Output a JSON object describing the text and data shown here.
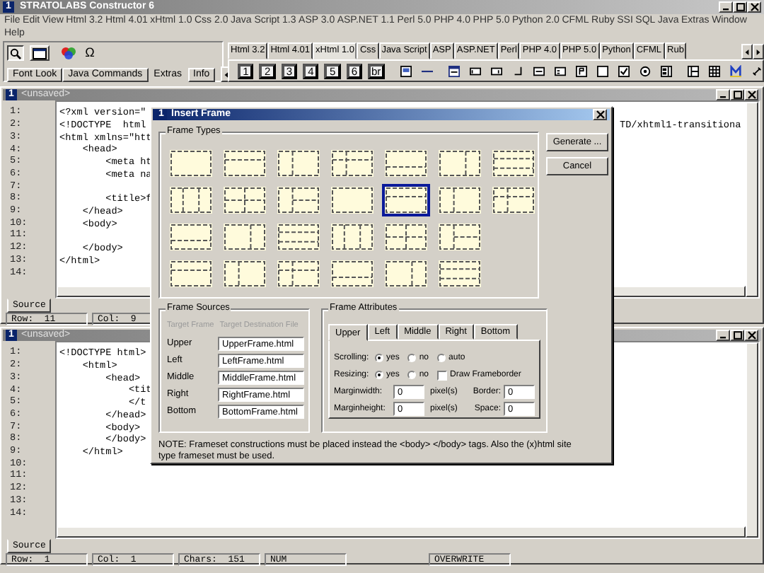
{
  "app": {
    "number": "1",
    "title": "STRATOLABS Constructor 6"
  },
  "menu": {
    "rows": [
      [
        "File",
        "Edit",
        "View",
        "Html 3.2",
        "Html 4.01",
        "xHtml 1.0",
        "Css 2.0",
        "Java Script 1.3",
        "ASP 3.0",
        "ASP.NET 1.1",
        "Perl 5.0",
        "PHP 4.0",
        "PHP 5.0",
        "Python 2.0",
        "CFML",
        "Ruby",
        "SSI",
        "SQL",
        "Java",
        "Extras",
        "Window"
      ],
      [
        "Help"
      ]
    ]
  },
  "side_toolbar": {
    "symbol_button": "Ω",
    "tabs": [
      {
        "label": "Font Look",
        "selected": false
      },
      {
        "label": "Java Commands",
        "selected": false
      },
      {
        "label": "Extras",
        "selected": true
      },
      {
        "label": "Info",
        "selected": false
      }
    ]
  },
  "language_tabs": [
    {
      "label": "Html 3.2",
      "selected": false
    },
    {
      "label": "Html 4.01",
      "selected": false
    },
    {
      "label": "xHtml 1.0",
      "selected": true
    },
    {
      "label": "Css",
      "selected": false
    },
    {
      "label": "Java Script",
      "selected": false
    },
    {
      "label": "ASP",
      "selected": false
    },
    {
      "label": "ASP.NET",
      "selected": false
    },
    {
      "label": "Perl",
      "selected": false
    },
    {
      "label": "PHP 4.0",
      "selected": false
    },
    {
      "label": "PHP 5.0",
      "selected": false
    },
    {
      "label": "Python",
      "selected": false
    },
    {
      "label": "CFML",
      "selected": false
    },
    {
      "label": "Rub",
      "selected": false
    }
  ],
  "heading_buttons": [
    "1",
    "2",
    "3",
    "4",
    "5",
    "6",
    "br"
  ],
  "editors": [
    {
      "number": "1",
      "title": "<unsaved>",
      "lines": [
        {
          "number": "1:",
          "text": "<?xml version=\""
        },
        {
          "number": "2:",
          "text": "<!DOCTYPE  html",
          "tail": "TD/xhtml1-transitiona"
        },
        {
          "number": "3:",
          "text": "<html xmlns=\"htt"
        },
        {
          "number": "4:",
          "text": "    <head>"
        },
        {
          "number": "5:",
          "text": "        <meta ht"
        },
        {
          "number": "6:",
          "text": "        <meta na"
        },
        {
          "number": "7:"
        },
        {
          "number": "8:",
          "text": "        <title>f"
        },
        {
          "number": "9:",
          "text": "    </head>"
        },
        {
          "number": "10:",
          "text": "    <body>"
        },
        {
          "number": "11:"
        },
        {
          "number": "12:",
          "text": "    </body>"
        },
        {
          "number": "13:",
          "text": "</html>"
        },
        {
          "number": "14:"
        }
      ],
      "tabs": [
        {
          "label": "Source",
          "selected": true
        }
      ],
      "status": [
        "Row:  11",
        "Col:  9"
      ]
    },
    {
      "number": "1",
      "title": "<unsaved>",
      "lines": [
        {
          "number": "1:",
          "text": "<!DOCTYPE html>"
        },
        {
          "number": "2:",
          "text": "    <html>"
        },
        {
          "number": "3:",
          "text": "        <head>"
        },
        {
          "number": "4:",
          "text": "            <tit"
        },
        {
          "number": "5:",
          "text": "            </t"
        },
        {
          "number": "6:",
          "text": "        </head>"
        },
        {
          "number": "7:",
          "text": "        <body>"
        },
        {
          "number": "8:",
          "text": "        </body>"
        },
        {
          "number": "9:",
          "text": "    </html>"
        },
        {
          "number": "10:"
        },
        {
          "number": "11:"
        },
        {
          "number": "12:"
        },
        {
          "number": "13:"
        },
        {
          "number": "14:"
        }
      ],
      "tabs": [
        {
          "label": "Source",
          "selected": true
        }
      ],
      "status": [
        "Row:  1",
        "Col:  1",
        "Chars:  151",
        "NUM",
        "OVERWRITE"
      ]
    }
  ],
  "insert_frame_dialog": {
    "number": "1",
    "title": "Insert Frame",
    "frame_types": {
      "label": "Frame Types",
      "rows": [
        [
          {
            "selected": false
          },
          {
            "selected": false
          },
          {
            "selected": false
          },
          {
            "selected": false
          },
          {
            "selected": false
          },
          {
            "selected": false
          },
          {
            "selected": false
          }
        ],
        [
          {
            "selected": false
          },
          {
            "selected": false
          },
          {
            "selected": false
          },
          {
            "selected": false
          },
          {
            "selected": true
          },
          {
            "selected": false
          },
          {
            "selected": false
          }
        ],
        [
          {
            "selected": false
          },
          {
            "selected": false
          },
          {
            "selected": false
          },
          {
            "selected": false
          },
          {
            "selected": false
          },
          {
            "selected": false
          }
        ],
        [
          {
            "selected": false
          },
          {
            "selected": false
          },
          {
            "selected": false
          },
          {
            "selected": false
          },
          {
            "selected": false
          },
          {
            "selected": false
          }
        ]
      ]
    },
    "buttons": [
      "Generate ...",
      "Cancel"
    ],
    "frame_sources": {
      "label": "Frame Sources",
      "columns": [
        "Target Frame",
        "Target Destination File"
      ],
      "rows": [
        {
          "frame": "Upper",
          "file": "UpperFrame.html"
        },
        {
          "frame": "Left",
          "file": "LeftFrame.html"
        },
        {
          "frame": "Middle",
          "file": "MiddleFrame.html"
        },
        {
          "frame": "Right",
          "file": "RightFrame.html"
        },
        {
          "frame": "Bottom",
          "file": "BottomFrame.html"
        }
      ]
    },
    "frame_attributes": {
      "label": "Frame Attributes",
      "tabs": [
        {
          "label": "Upper",
          "selected": true
        },
        {
          "label": "Left",
          "selected": false
        },
        {
          "label": "Middle",
          "selected": false
        },
        {
          "label": "Right",
          "selected": false
        },
        {
          "label": "Bottom",
          "selected": false
        }
      ],
      "scrolling": {
        "label": "Scrolling:",
        "options": [
          {
            "label": "yes",
            "selected": true
          },
          {
            "label": "no",
            "selected": false
          },
          {
            "label": "auto",
            "selected": false
          }
        ]
      },
      "resizing": {
        "label": "Resizing:",
        "options": [
          {
            "label": "yes",
            "selected": true
          },
          {
            "label": "no",
            "selected": false
          }
        ]
      },
      "draw_frameborder": {
        "label": "Draw Frameborder",
        "checked": false
      },
      "marginwidth": {
        "label": "Marginwidth:",
        "value": "0",
        "unit": "pixel(s)"
      },
      "border": {
        "label": "Border:",
        "value": "0"
      },
      "marginheight": {
        "label": "Marginheight:",
        "value": "0",
        "unit": "pixel(s)"
      },
      "space": {
        "label": "Space:",
        "value": "0"
      }
    },
    "note": "NOTE: Frameset constructions must be placed instead the <body> </body> tags. Also the (x)html site type frameset must be used."
  }
}
